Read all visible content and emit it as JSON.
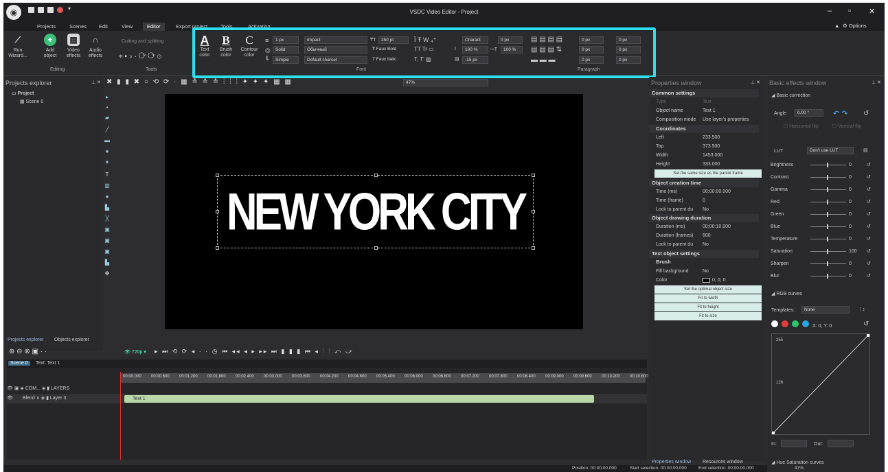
{
  "app": {
    "title": "VSDC Video Editor - Project",
    "options": "Options"
  },
  "menu": [
    "Projects",
    "Scenes",
    "Edit",
    "View",
    "Editor",
    "Export project",
    "Tools",
    "Activation"
  ],
  "ribbon": {
    "run_wizard": "Run\nWizard...",
    "add_object": "Add\nobject",
    "video_effects": "Video\neffects",
    "audio_effects": "Audio\neffects",
    "editing_label": "Editing",
    "cutting": "Cutting and splitting",
    "tools_label": "Tools",
    "text_color": "Text\ncolor",
    "brush_color": "Brush\ncolor",
    "contour_color": "Contour\ncolor",
    "line_width": "1 px",
    "fill_solid": "Solid",
    "line_simple": "Simple",
    "font_name": "Impact",
    "font_style": "Обычный",
    "charset": "Default charset",
    "font_size": "250 pt",
    "faux_bold": "Faux Bold",
    "faux_italic": "Faux Italic",
    "char_mode": "Charact",
    "char_spacing": "0 px",
    "scale_h": "100 %",
    "scale_v": "100 %",
    "baseline": "-15 px",
    "font_label": "Font",
    "paragraph_label": "Paragraph",
    "para_values": [
      "0 px",
      "0 px",
      "0 px",
      "0 px",
      "0 px",
      "0 px"
    ]
  },
  "projects_explorer": {
    "title": "Projects explorer",
    "project": "Project",
    "scene": "Scene 0",
    "tab1": "Projects explorer",
    "tab2": "Objects explorer"
  },
  "toolbar": {
    "zoom": "47%",
    "resolution": "720p"
  },
  "canvas": {
    "text": "NEW YORK CITY"
  },
  "properties": {
    "title": "Properties window",
    "common": "Common settings",
    "type_k": "Type",
    "type_v": "Text",
    "name_k": "Object name",
    "name_v": "Text 1",
    "comp_k": "Composition mode",
    "comp_v": "Use layer's properties",
    "coords": "Coordinates",
    "left_k": "Left",
    "left_v": "233.500",
    "top_k": "Top",
    "top_v": "373.500",
    "width_k": "Width",
    "width_v": "1453.000",
    "height_k": "Height",
    "height_v": "333.000",
    "same_size": "Set the same size as the parent frame",
    "creation": "Object creation time",
    "tms_k": "Time (ms)",
    "tms_v": "00:00:00.000",
    "tfr_k": "Time (frame)",
    "tfr_v": "0",
    "lock1_k": "Lock to parent du",
    "lock1_v": "No",
    "drawing": "Object drawing duration",
    "dms_k": "Duration (ms)",
    "dms_v": "00:00:10.000",
    "dfr_k": "Duration (frames)",
    "dfr_v": "600",
    "lock2_k": "Lock to parent du",
    "lock2_v": "No",
    "textset": "Text object settings",
    "brush": "Brush",
    "fillbg_k": "Fill background",
    "fillbg_v": "No",
    "color_k": "Color",
    "color_v": "0; 0; 0",
    "optimal": "Set the optimal object size",
    "fit_width": "Fit to width",
    "fit_height": "Fit to height",
    "fit_size": "Fit to size",
    "tab1": "Properties window",
    "tab2": "Resources window"
  },
  "effects": {
    "title": "Basic effects window",
    "basic": "Basic correction",
    "angle_k": "Angle",
    "angle_v": "0.00 °",
    "hflip": "Horizontal flip",
    "vflip": "Vertical flip",
    "lut_k": "LUT",
    "lut_v": "Don't use LUT",
    "rows": [
      [
        "Brightness",
        "0"
      ],
      [
        "Contrast",
        "0"
      ],
      [
        "Gamma",
        "0"
      ],
      [
        "Red",
        "0"
      ],
      [
        "Green",
        "0"
      ],
      [
        "Blue",
        "0"
      ],
      [
        "Temperature",
        "0"
      ],
      [
        "Saturation",
        "100"
      ],
      [
        "Sharpen",
        "0"
      ],
      [
        "Blur",
        "0"
      ]
    ],
    "rgb": "RGB curves",
    "templates_k": "Templates:",
    "templates_v": "None",
    "xy": "X: 0, Y: 0",
    "c255": "255",
    "c128": "128",
    "in_k": "In:",
    "out_k": "Out:",
    "hue": "Hue Saturation curves"
  },
  "timeline": {
    "tab_scene": "Scene 0",
    "tab_text": "Text: Text 1",
    "com": "COM...",
    "layers": "LAYERS",
    "blend": "Blend",
    "layer": "Layer 3",
    "clip": "Text 1",
    "ticks": [
      "00:00.000",
      "00:00.600",
      "00:01.200",
      "00:01.800",
      "00:02.400",
      "00:03.000",
      "00:03.600",
      "00:04.200",
      "00:04.800",
      "00:05.400",
      "00:06.000",
      "00:06.600",
      "00:07.200",
      "00:07.800",
      "00:08.400",
      "00:09.000",
      "00:09.600",
      "00:10.200",
      "00:10.800"
    ]
  },
  "status": {
    "position": "Position:  00:00:00.000",
    "start": "Start selection:  00:00:00.000",
    "end": "End selection:  00:00:00.000",
    "zoom": "47%"
  },
  "colors": {
    "highlight": "#2ee0ef",
    "accent": "#1e90ff",
    "clip": "#b9d7a8"
  }
}
